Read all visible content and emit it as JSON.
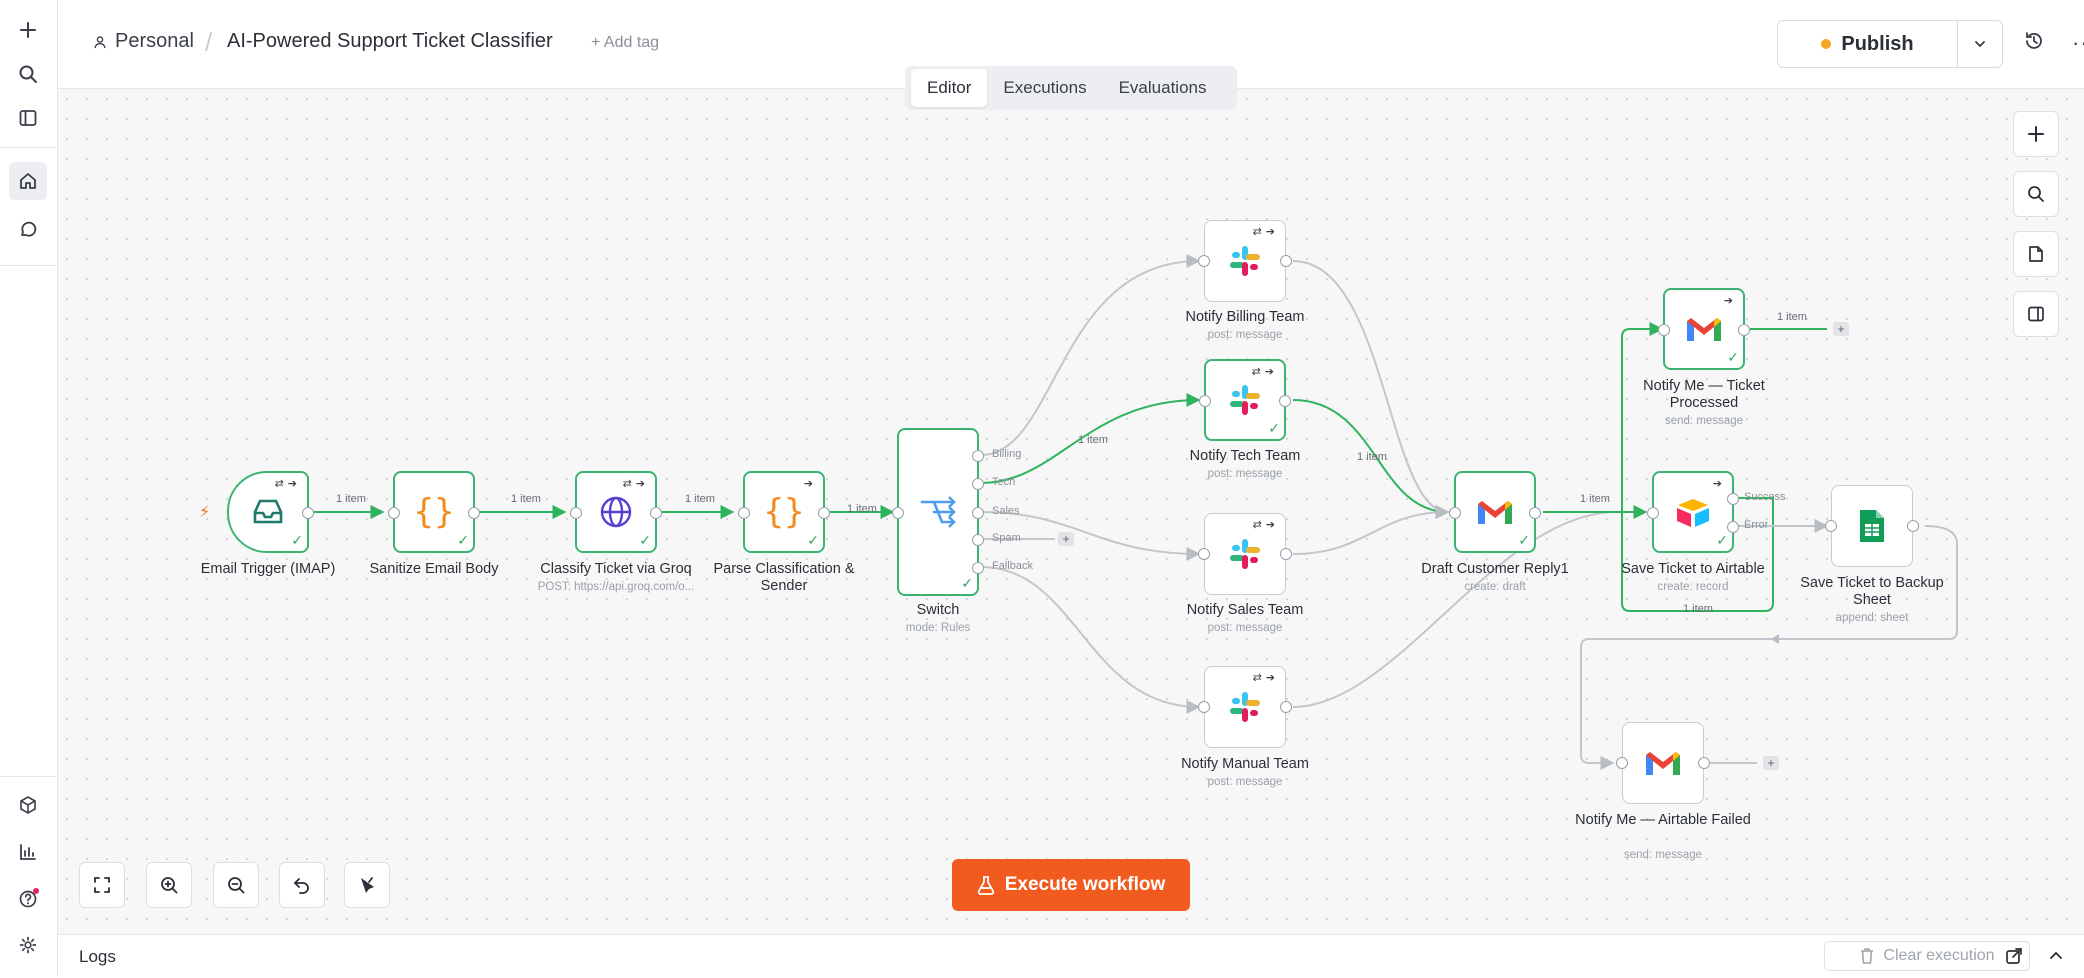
{
  "header": {
    "project": "Personal",
    "workflow_title": "AI-Powered Support Ticket Classifier",
    "add_tag": "+ Add tag",
    "publish_label": "Publish",
    "more_label": "···"
  },
  "tabs": [
    {
      "label": "Editor",
      "active": true
    },
    {
      "label": "Executions",
      "active": false
    },
    {
      "label": "Evaluations",
      "active": false
    }
  ],
  "nodes": {
    "email_trigger": {
      "label": "Email Trigger (IMAP)"
    },
    "sanitize": {
      "label": "Sanitize Email Body"
    },
    "classify": {
      "label": "Classify Ticket via Groq",
      "sub": "POST: https://api.groq.com/o..."
    },
    "parse": {
      "label": "Parse Classification & Sender"
    },
    "switch": {
      "label": "Switch",
      "sub": "mode: Rules",
      "outputs": [
        "Billing",
        "Tech",
        "Sales",
        "Spam",
        "Fallback"
      ]
    },
    "billing": {
      "label": "Notify Billing Team",
      "sub": "post: message"
    },
    "tech": {
      "label": "Notify Tech Team",
      "sub": "post: message"
    },
    "sales": {
      "label": "Notify Sales Team",
      "sub": "post: message"
    },
    "manual": {
      "label": "Notify Manual Team",
      "sub": "post: message"
    },
    "draft": {
      "label": "Draft Customer Reply1",
      "sub": "create: draft"
    },
    "notify_processed": {
      "label": "Notify Me — Ticket Processed",
      "sub": "send: message"
    },
    "airtable": {
      "label": "Save Ticket to Airtable",
      "sub": "create: record",
      "outputs": [
        "Success",
        "Error"
      ]
    },
    "backup": {
      "label": "Save Ticket to Backup Sheet",
      "sub": "append: sheet"
    },
    "notify_failed": {
      "label": "Notify Me — Airtable Failed",
      "sub": "send: message"
    }
  },
  "edge_labels": {
    "trigger_sanitize": "1 item",
    "sanitize_classify": "1 item",
    "classify_parse": "1 item",
    "parse_switch": "1 item",
    "switch_tech": "1 item",
    "tech_draft": "1 item",
    "draft_airtable": "1 item",
    "processed_out": "1 item",
    "airtable_loop": "1 item"
  },
  "canvas": {
    "execute_label": "Execute workflow"
  },
  "logs": {
    "title": "Logs",
    "clear_label": "Clear execution"
  },
  "colors": {
    "accent": "#f25b1f",
    "success": "#3cb371",
    "publish_dot": "#f5a623"
  }
}
